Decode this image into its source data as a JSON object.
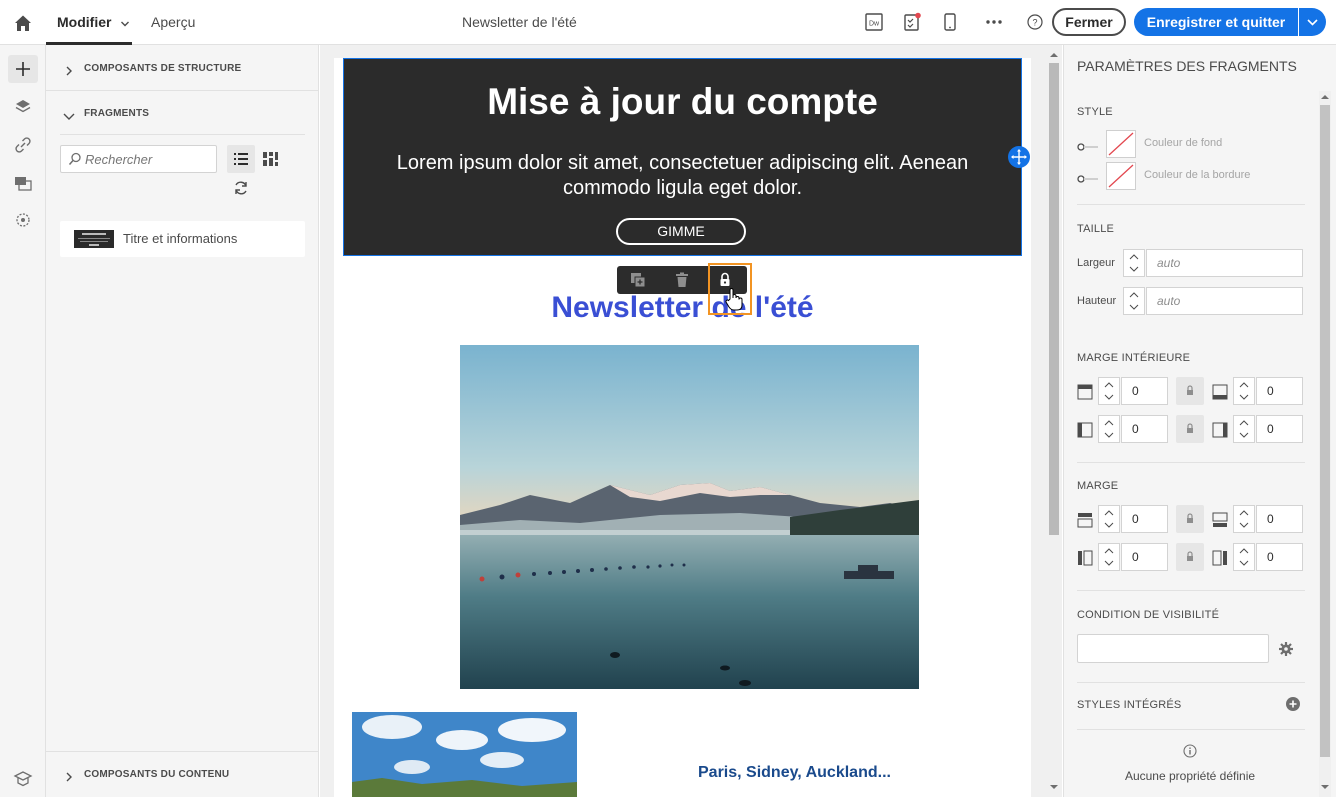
{
  "topbar": {
    "home_icon": "home-icon",
    "tab_edit": "Modifier",
    "tab_preview": "Aperçu",
    "document_title": "Newsletter de l'été",
    "close_label": "Fermer",
    "save_label": "Enregistrer et quitter",
    "accent_color": "#1473e6"
  },
  "left_panel": {
    "structure_components": "COMPOSANTS DE STRUCTURE",
    "fragments": "FRAGMENTS",
    "search_placeholder": "Rechercher",
    "fragment_items": [
      {
        "label": "Titre et informations"
      }
    ],
    "content_components": "COMPOSANTS DU CONTENU"
  },
  "canvas": {
    "hero_title": "Mise à jour du compte",
    "hero_text": "Lorem ipsum dolor sit amet, consectetuer adipiscing elit. Aenean commodo ligula eget dolor.",
    "hero_button": "GIMME",
    "newsletter_title": "Newsletter de l'été",
    "city_title": "Paris, Sidney, Auckland..."
  },
  "right_panel": {
    "title": "PARAMÈTRES DES FRAGMENTS",
    "style_head": "STYLE",
    "background_color_label": "Couleur de fond",
    "border_color_label": "Couleur de la bordure",
    "size_head": "TAILLE",
    "width_label": "Largeur",
    "width_value": "auto",
    "height_label": "Hauteur",
    "height_value": "auto",
    "padding_head": "MARGE INTÉRIEURE",
    "padding_values": [
      "0",
      "0",
      "0",
      "0"
    ],
    "margin_head": "MARGE",
    "margin_values": [
      "0",
      "0",
      "0",
      "0"
    ],
    "visibility_head": "CONDITION DE VISIBILITÉ",
    "inline_styles_head": "STYLES INTÉGRÉS",
    "no_properties": "Aucune propriété définie"
  }
}
